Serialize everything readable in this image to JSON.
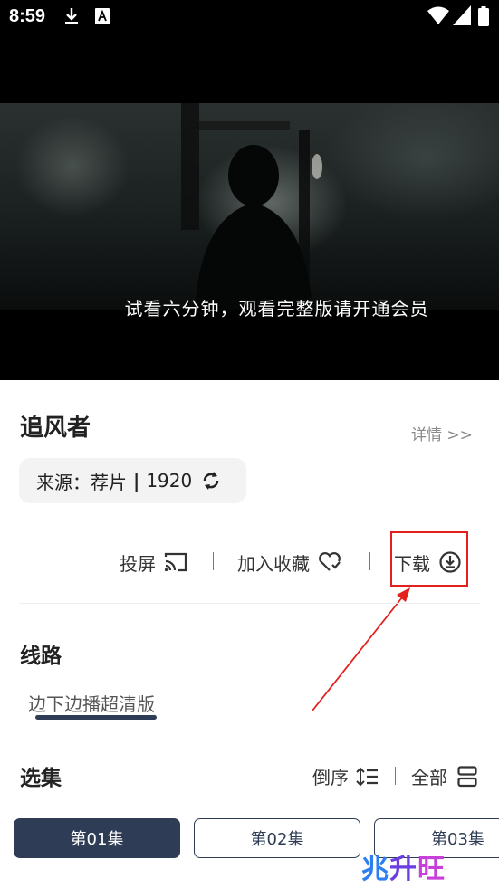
{
  "status_bar": {
    "time": "8:59",
    "icons": [
      "download-icon",
      "a-notification-icon",
      "wifi-icon",
      "signal-icon",
      "battery-icon"
    ]
  },
  "player": {
    "subtitle": "试看六分钟，观看完整版请开通会员"
  },
  "movie": {
    "title": "追风者",
    "detail_link": "详情 >>",
    "source_label": "来源：荐片",
    "source_separator": "|",
    "source_value": "1920"
  },
  "actions": {
    "cast": "投屏",
    "favorite": "加入收藏",
    "download": "下载",
    "separator": "|"
  },
  "route": {
    "heading": "线路",
    "selected": "边下边播超清版"
  },
  "episodes": {
    "heading": "选集",
    "reverse": "倒序",
    "all": "全部",
    "separator": "|",
    "items": [
      "第01集",
      "第02集",
      "第03集"
    ]
  },
  "watermark": {
    "part1": "兆",
    "part2": "升",
    "part3": "旺"
  },
  "colors": {
    "accent": "#2e3d55",
    "highlight": "#e4201d",
    "chip_bg": "#f3f3f3"
  }
}
